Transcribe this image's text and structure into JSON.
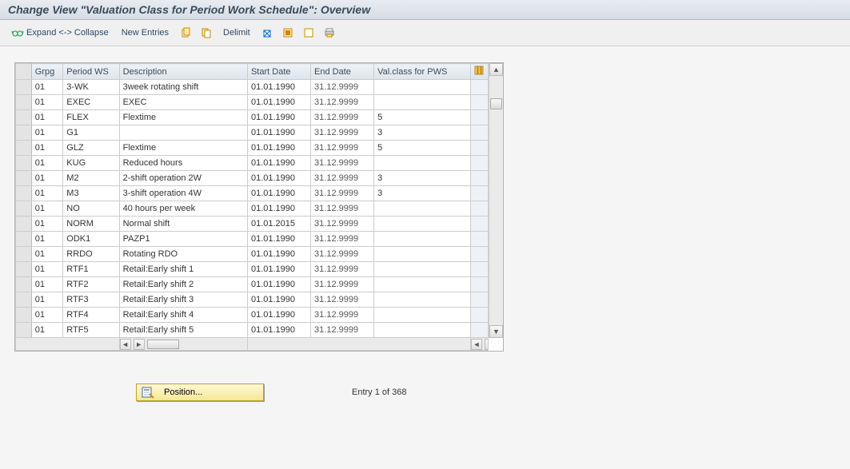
{
  "title": "Change View \"Valuation Class for Period Work Schedule\": Overview",
  "toolbar": {
    "expand_collapse": "Expand <-> Collapse",
    "new_entries": "New Entries",
    "delimit": "Delimit"
  },
  "columns": {
    "rowsel": "",
    "grpg": "Grpg",
    "pws": "Period WS",
    "desc": "Description",
    "sd": "Start Date",
    "ed": "End Date",
    "val": "Val.class for PWS"
  },
  "rows": [
    {
      "grpg": "01",
      "pws": "3-WK",
      "desc": "3week rotating shift",
      "sd": "01.01.1990",
      "ed": "31.12.9999",
      "val": ""
    },
    {
      "grpg": "01",
      "pws": "EXEC",
      "desc": "EXEC",
      "sd": "01.01.1990",
      "ed": "31.12.9999",
      "val": ""
    },
    {
      "grpg": "01",
      "pws": "FLEX",
      "desc": "Flextime",
      "sd": "01.01.1990",
      "ed": "31.12.9999",
      "val": "5"
    },
    {
      "grpg": "01",
      "pws": "G1",
      "desc": "",
      "sd": "01.01.1990",
      "ed": "31.12.9999",
      "val": "3"
    },
    {
      "grpg": "01",
      "pws": "GLZ",
      "desc": "Flextime",
      "sd": "01.01.1990",
      "ed": "31.12.9999",
      "val": "5"
    },
    {
      "grpg": "01",
      "pws": "KUG",
      "desc": "Reduced hours",
      "sd": "01.01.1990",
      "ed": "31.12.9999",
      "val": ""
    },
    {
      "grpg": "01",
      "pws": "M2",
      "desc": "2-shift operation 2W",
      "sd": "01.01.1990",
      "ed": "31.12.9999",
      "val": "3"
    },
    {
      "grpg": "01",
      "pws": "M3",
      "desc": "3-shift operation 4W",
      "sd": "01.01.1990",
      "ed": "31.12.9999",
      "val": "3"
    },
    {
      "grpg": "01",
      "pws": "NO",
      "desc": "40 hours per week",
      "sd": "01.01.1990",
      "ed": "31.12.9999",
      "val": ""
    },
    {
      "grpg": "01",
      "pws": "NORM",
      "desc": "Normal shift",
      "sd": "01.01.2015",
      "ed": "31.12.9999",
      "val": ""
    },
    {
      "grpg": "01",
      "pws": "ODK1",
      "desc": "PAZP1",
      "sd": "01.01.1990",
      "ed": "31.12.9999",
      "val": ""
    },
    {
      "grpg": "01",
      "pws": "RRDO",
      "desc": "Rotating RDO",
      "sd": "01.01.1990",
      "ed": "31.12.9999",
      "val": ""
    },
    {
      "grpg": "01",
      "pws": "RTF1",
      "desc": "Retail:Early shift 1",
      "sd": "01.01.1990",
      "ed": "31.12.9999",
      "val": ""
    },
    {
      "grpg": "01",
      "pws": "RTF2",
      "desc": "Retail:Early shift 2",
      "sd": "01.01.1990",
      "ed": "31.12.9999",
      "val": ""
    },
    {
      "grpg": "01",
      "pws": "RTF3",
      "desc": "Retail:Early shift 3",
      "sd": "01.01.1990",
      "ed": "31.12.9999",
      "val": ""
    },
    {
      "grpg": "01",
      "pws": "RTF4",
      "desc": "Retail:Early shift 4",
      "sd": "01.01.1990",
      "ed": "31.12.9999",
      "val": ""
    },
    {
      "grpg": "01",
      "pws": "RTF5",
      "desc": "Retail:Early shift 5",
      "sd": "01.01.1990",
      "ed": "31.12.9999",
      "val": ""
    }
  ],
  "footer": {
    "position_label": "Position...",
    "entry_text": "Entry 1 of 368"
  },
  "colors": {
    "header_bg": "#dde4ec",
    "accent_yellow": "#f5e795"
  }
}
